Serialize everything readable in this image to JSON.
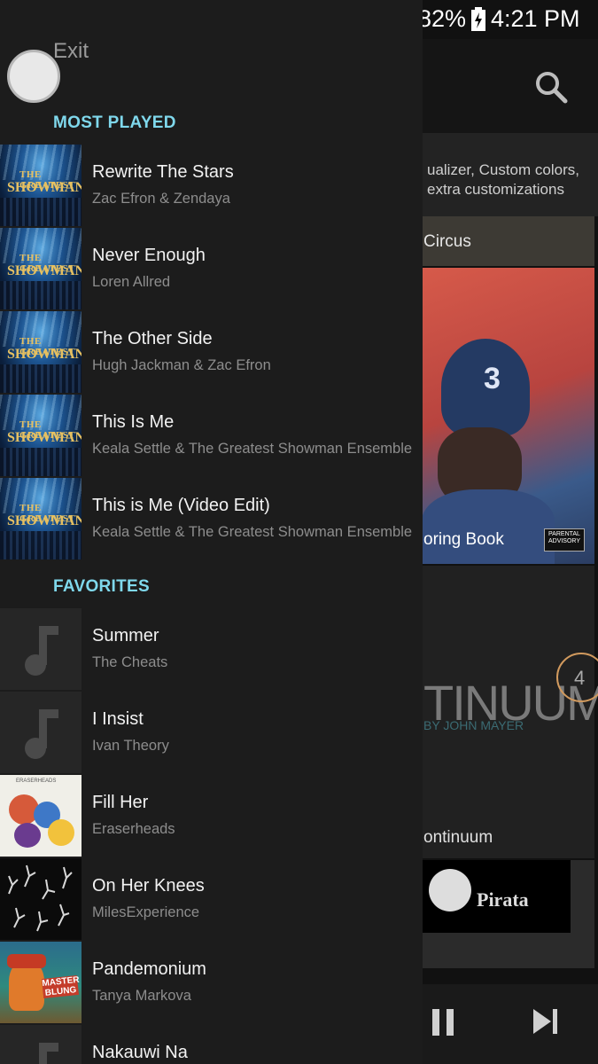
{
  "status_bar": {
    "battery_percent": "82%",
    "time": "4:21 PM"
  },
  "background": {
    "promo_line1": "ualizer, Custom colors,",
    "promo_line2": "extra customizations",
    "album_circus": "Circus",
    "album_coloring": "oring Book",
    "album_continuum_art": "TINUUM",
    "album_continuum_sub": "BY JOHN MAYER",
    "album_continuum": "ontinuum",
    "badge_count": "4",
    "pirata": "Pirata"
  },
  "drawer": {
    "exit_label": "Exit",
    "most_played_title": "MOST PLAYED",
    "favorites_title": "FAVORITES",
    "most_played": [
      {
        "title": "Rewrite The Stars",
        "artist": "Zac Efron & Zendaya"
      },
      {
        "title": "Never Enough",
        "artist": "Loren Allred"
      },
      {
        "title": "The Other Side",
        "artist": "Hugh Jackman & Zac Efron"
      },
      {
        "title": "This Is Me",
        "artist": "Keala Settle & The Greatest Showman Ensemble"
      },
      {
        "title": "This is Me (Video Edit)",
        "artist": "Keala Settle & The Greatest Showman Ensemble"
      }
    ],
    "favorites": [
      {
        "title": "Summer",
        "artist": "The Cheats"
      },
      {
        "title": "I Insist",
        "artist": "Ivan Theory"
      },
      {
        "title": "Fill Her",
        "artist": "Eraserheads"
      },
      {
        "title": "On Her Knees",
        "artist": "MilesExperience"
      },
      {
        "title": "Pandemonium",
        "artist": "Tanya Markova"
      },
      {
        "title": "Nakauwi Na",
        "artist": ""
      }
    ],
    "cover_text": {
      "greatest_top": "THE GREATEST",
      "greatest_bottom": "SHOWMAN",
      "pandemonium": "MASTER BLUNG"
    }
  },
  "colors": {
    "accent": "#7fd8ec",
    "drawer_bg": "#1c1c1c"
  },
  "icons": {
    "app": "play-circle-icon",
    "mute": "vibrate-mute-icon",
    "signal": "signal-icon",
    "battery": "battery-icon",
    "search": "search-icon",
    "note": "music-note-icon",
    "pause": "pause-icon",
    "next": "skip-next-icon"
  }
}
